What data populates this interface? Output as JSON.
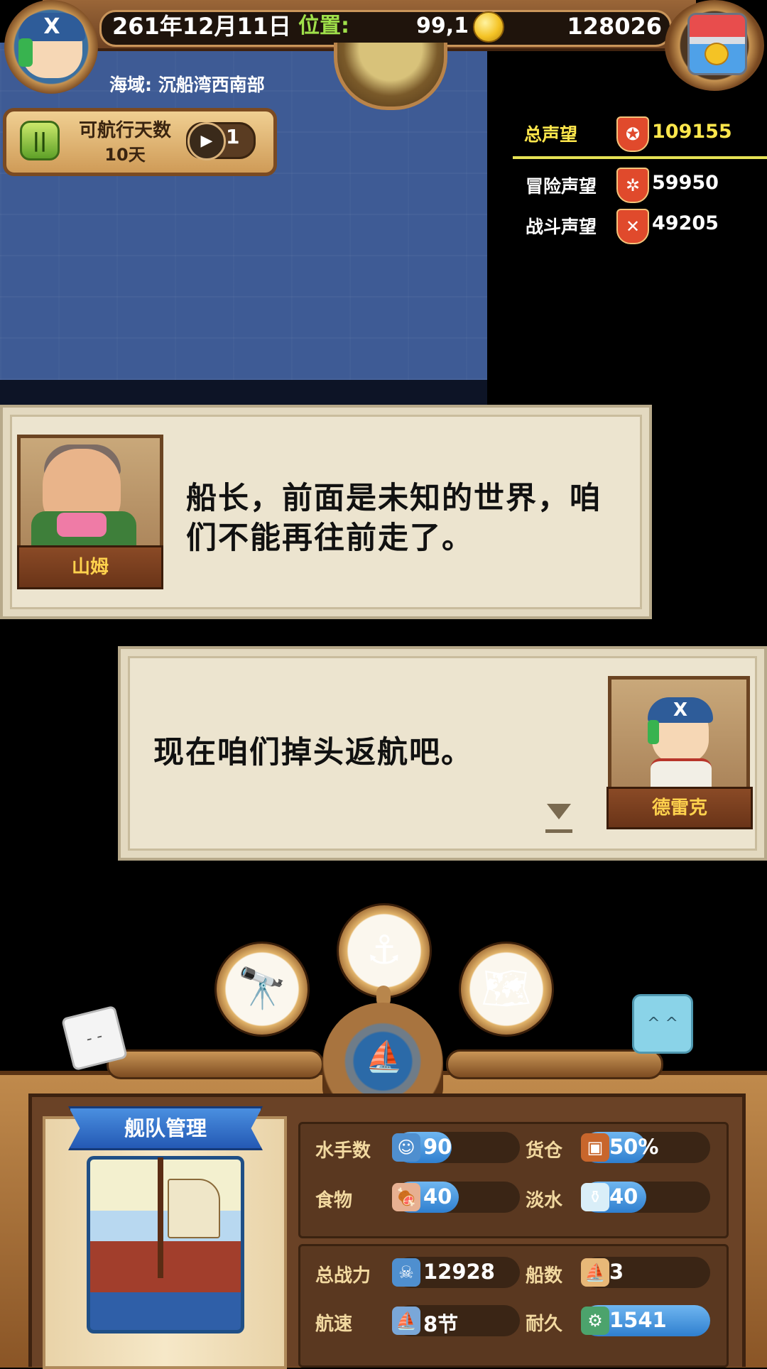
{
  "hud": {
    "date": "261年12月11日",
    "position_label": "位置:",
    "position_value": "99,1",
    "gold": "128026",
    "sea_region": "海域:  沉船湾西南部",
    "avatar_symbol": "X",
    "days_label": "可航行天数",
    "days_value": "10天",
    "pause_symbol": "||",
    "play_symbol": "▶",
    "speed": "1"
  },
  "reputation": {
    "total_label": "总声望",
    "total_value": "109155",
    "total_color": "#ffe74c",
    "adventure_label": "冒险声望",
    "adventure_value": "59950",
    "battle_label": "战斗声望",
    "battle_value": "49205",
    "total_icon": "shield-icon",
    "adventure_icon": "compass-rose-icon",
    "battle_icon": "crossed-swords-icon"
  },
  "dialogues": [
    {
      "speaker": "山姆",
      "text_line1": "船长，前面是未知的世界，咱",
      "text_line2": "们不能再往前走了。"
    },
    {
      "speaker": "德雷克",
      "text_line1": "现在咱们掉头返航吧。"
    }
  ],
  "bottom_nav": {
    "telescope_icon": "telescope-icon",
    "anchor_icon": "anchor-icon",
    "map_icon": "world-map-icon",
    "ship_icon": "ship-icon"
  },
  "fleet": {
    "title": "舰队管理",
    "stats": {
      "sailors_label": "水手数",
      "sailors_value": "90",
      "cargo_label": "货仓",
      "cargo_value": "50%",
      "cargo_fill": 0.5,
      "food_label": "食物",
      "food_value": "40",
      "water_label": "淡水",
      "water_value": "40",
      "power_label": "总战力",
      "power_value": "12928",
      "ships_label": "船数",
      "ships_value": "3",
      "speed_label": "航速",
      "speed_value": "8节",
      "durability_label": "耐久",
      "durability_value": "1541"
    }
  }
}
